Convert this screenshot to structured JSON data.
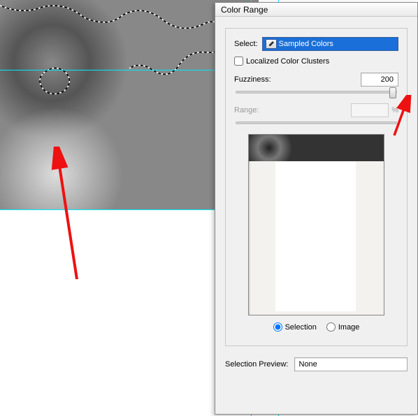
{
  "dialog": {
    "title": "Color Range",
    "select_label": "Select:",
    "select_value": "Sampled Colors",
    "localized_label": "Localized Color Clusters",
    "localized_checked": false,
    "fuzziness_label": "Fuzziness:",
    "fuzziness_value": "200",
    "fuzziness_percent": 100,
    "range_label": "Range:",
    "range_value": "",
    "range_unit": "%",
    "preview_mode": {
      "selection_label": "Selection",
      "image_label": "Image",
      "selected": "selection"
    },
    "selection_preview_label": "Selection Preview:",
    "selection_preview_value": "None"
  }
}
